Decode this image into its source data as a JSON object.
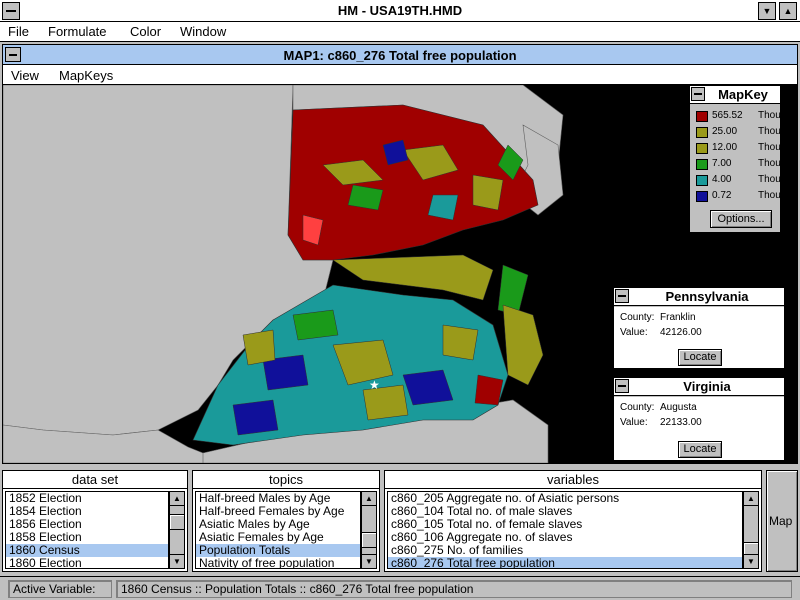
{
  "app": {
    "title": "HM - USA19TH.HMD",
    "menu": [
      "File",
      "Formulate",
      "Color",
      "Window"
    ]
  },
  "map_window": {
    "title": "MAP1: c860_276 Total free population",
    "menu": [
      "View",
      "MapKeys"
    ]
  },
  "mapkey": {
    "title": "MapKey",
    "entries": [
      {
        "value": "565.52",
        "unit": "Thous",
        "color": "#a00000"
      },
      {
        "value": "25.00",
        "unit": "Thous",
        "color": "#9a9a1a"
      },
      {
        "value": "12.00",
        "unit": "Thous",
        "color": "#9a9a1a"
      },
      {
        "value": "7.00",
        "unit": "Thous",
        "color": "#1a9a1a"
      },
      {
        "value": "4.00",
        "unit": "Thous",
        "color": "#1a9a9a"
      },
      {
        "value": "0.72",
        "unit": "Thous",
        "color": "#10109a"
      }
    ],
    "options_label": "Options..."
  },
  "info_panels": [
    {
      "title": "Pennsylvania",
      "county_label": "County:",
      "county": "Franklin",
      "value_label": "Value:",
      "value": "42126.00",
      "button": "Locate"
    },
    {
      "title": "Virginia",
      "county_label": "County:",
      "county": "Augusta",
      "value_label": "Value:",
      "value": "22133.00",
      "button": "Locate"
    }
  ],
  "data_set": {
    "title": "data set",
    "items": [
      "1852 Election",
      "1854 Election",
      "1856 Election",
      "1858 Election",
      "1860 Census",
      "1860 Election"
    ],
    "selected": 4
  },
  "topics": {
    "title": "topics",
    "items": [
      "Half-breed Males by Age",
      "Half-breed Females by Age",
      "Asiatic Males by Age",
      "Asiatic Females by Age",
      "Population Totals",
      "Nativity of free population"
    ],
    "selected": 4
  },
  "variables": {
    "title": "variables",
    "items": [
      "c860_205 Aggregate no. of Asiatic persons",
      "c860_104 Total no. of male slaves",
      "c860_105 Total no. of female slaves",
      "c860_106 Aggregate no. of slaves",
      "c860_275 No. of families",
      "c860_276 Total free population"
    ],
    "selected": 5
  },
  "map_button": "Map",
  "status": {
    "label": "Active Variable:",
    "value": "1860 Census :: Population Totals :: c860_276 Total free population"
  },
  "colors": {
    "grey_county": "#c0c0c0",
    "background": "#000000",
    "selection": "#a8c8f0"
  }
}
